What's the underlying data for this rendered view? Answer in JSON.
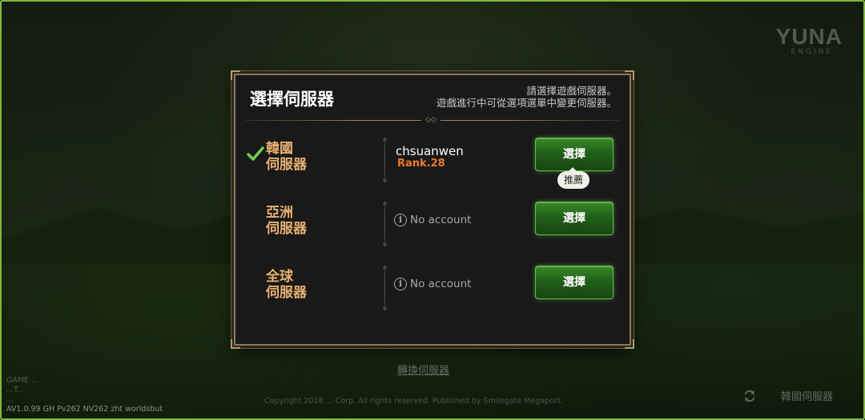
{
  "background": {
    "logo": "YUNA",
    "logo_sub": "ENGINE",
    "below_dialog_link": "轉換伺服器",
    "copyright": "Copyright 2018 ... Corp. All rights reserved. Published by Smilegate Megaport.",
    "build_info": [
      "GAME ...",
      "...T...",
      "...",
      "AV1.0.99 GH Pv262 NV262 zht worldsbut"
    ],
    "current_server_label": "韓國伺服器",
    "refresh_icon": "refresh-icon"
  },
  "dialog": {
    "title": "選擇伺服器",
    "description_line1": "請選擇遊戲伺服器。",
    "description_line2": "遊戲進行中可從選項選單中變更伺服器。",
    "divider_ornament": "◇◇"
  },
  "servers": [
    {
      "name_line1": "韓國",
      "name_line2": "伺服器",
      "selected": true,
      "account_name": "chsuanwen",
      "account_rank": "Rank.28",
      "button_label": "選擇",
      "recommend_label": "推薦"
    },
    {
      "name_line1": "亞洲",
      "name_line2": "伺服器",
      "selected": false,
      "no_account": "No account",
      "button_label": "選擇"
    },
    {
      "name_line1": "全球",
      "name_line2": "伺服器",
      "selected": false,
      "no_account": "No account",
      "button_label": "選擇"
    }
  ],
  "colors": {
    "accent_green": "#5fc04a",
    "server_name": "#e7b071",
    "rank": "#f07a2c",
    "check": "#6fd14a"
  }
}
